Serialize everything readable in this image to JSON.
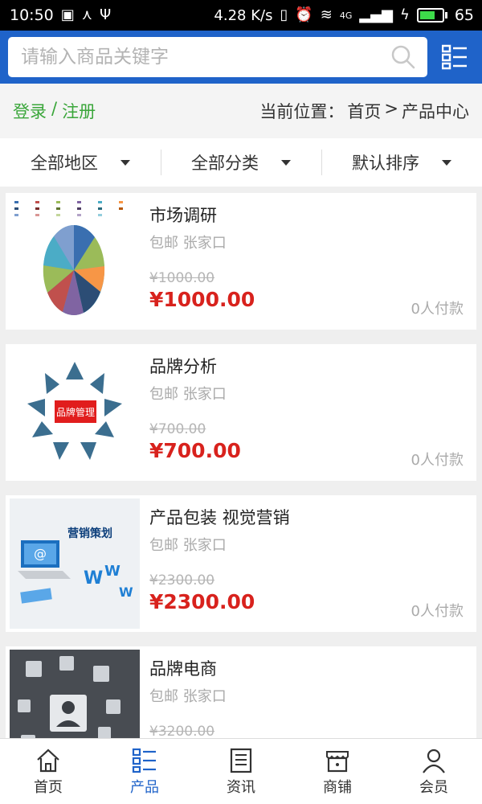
{
  "status_bar": {
    "time": "10:50",
    "speed": "4.28 K/s",
    "network": "4G",
    "battery": "65"
  },
  "search": {
    "placeholder": "请输入商品关键字"
  },
  "breadcrumb_row": {
    "login": "登录",
    "separator": "/",
    "register": "注册",
    "location_label": "当前位置：",
    "home": "首页",
    "arrow": ">",
    "current": "产品中心"
  },
  "filters": [
    {
      "label": "全部地区"
    },
    {
      "label": "全部分类"
    },
    {
      "label": "默认排序"
    }
  ],
  "products": [
    {
      "name": "市场调研",
      "meta": "包邮 张家口",
      "old_price": "¥1000.00",
      "price": "¥1000.00",
      "paid": "0人付款",
      "image": "pie-chart-image"
    },
    {
      "name": "品牌分析",
      "meta": "包邮 张家口",
      "old_price": "¥700.00",
      "price": "¥700.00",
      "paid": "0人付款",
      "image": "brand-management-diagram",
      "image_text": "品牌管理"
    },
    {
      "name": "产品包装 视觉营销",
      "meta": "包邮 张家口",
      "old_price": "¥2300.00",
      "price": "¥2300.00",
      "paid": "0人付款",
      "image": "marketing-plan-image",
      "image_text": "营销策划"
    },
    {
      "name": "品牌电商",
      "meta": "包邮 张家口",
      "old_price": "¥3200.00",
      "price": "",
      "paid": "",
      "image": "ecommerce-touch-image"
    }
  ],
  "tabbar": [
    {
      "label": "首页",
      "icon": "home-icon",
      "active": false
    },
    {
      "label": "产品",
      "icon": "list-icon",
      "active": true
    },
    {
      "label": "资讯",
      "icon": "news-icon",
      "active": false
    },
    {
      "label": "商铺",
      "icon": "store-icon",
      "active": false
    },
    {
      "label": "会员",
      "icon": "user-icon",
      "active": false
    }
  ],
  "colors": {
    "header": "#1f63c9",
    "login_green": "#3aa63a",
    "price_red": "#d8221d",
    "active_tab": "#1f63c9"
  }
}
